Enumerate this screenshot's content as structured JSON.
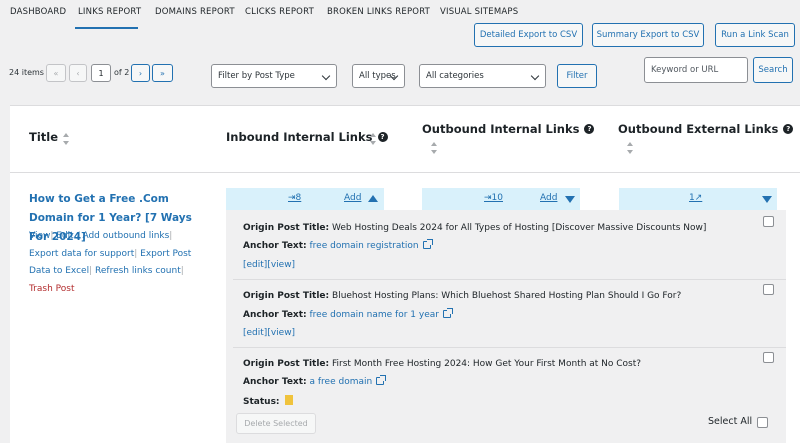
{
  "nav": {
    "tabs": [
      "DASHBOARD",
      "LINKS REPORT",
      "DOMAINS REPORT",
      "CLICKS REPORT",
      "BROKEN LINKS REPORT",
      "VISUAL SITEMAPS"
    ]
  },
  "actions": {
    "detailed_export": "Detailed Export to CSV",
    "summary_export": "Summary Export to CSV",
    "run_scan": "Run a Link Scan"
  },
  "pagination": {
    "items_count": "24 items",
    "first": "«",
    "prev": "‹",
    "current_page": "1",
    "of_total": "of 2",
    "next": "›",
    "last": "»"
  },
  "filters": {
    "post_type": "Filter by Post Type",
    "types": "All types",
    "categories": "All categories",
    "filter_button": "Filter",
    "search_placeholder": "Keyword or URL",
    "search_button": "Search"
  },
  "table": {
    "headers": {
      "title": "Title",
      "inbound": "Inbound Internal Links",
      "outbound_internal": "Outbound Internal Links",
      "outbound_external": "Outbound External Links"
    },
    "help_glyph": "?"
  },
  "row": {
    "title": "How to Get a Free .Com Domain for 1 Year? [7 Ways For 2024]",
    "actions": {
      "view": "View",
      "edit": "Edit / Add outbound links",
      "export": "Export data for support",
      "export_excel": "Export Post Data to Excel",
      "refresh": "Refresh links count",
      "trash": "Trash Post",
      "sep": "|"
    },
    "inbound_count": "⇥8",
    "outbound_internal_count": "⇥10",
    "outbound_external_count": "1↗",
    "add_label": "Add"
  },
  "entries": [
    {
      "origin_label": "Origin Post Title:",
      "origin_title": "Web Hosting Deals 2024 for All Types of Hosting [Discover Massive Discounts Now]",
      "anchor_label": "Anchor Text:",
      "anchor_text": "free domain registration",
      "edit": "[edit]",
      "view": "[view]"
    },
    {
      "origin_label": "Origin Post Title:",
      "origin_title": "Bluehost Hosting Plans: Which Bluehost Shared Hosting Plan Should I Go For?",
      "anchor_label": "Anchor Text:",
      "anchor_text": "free domain name for 1 year",
      "edit": "[edit]",
      "view": "[view]"
    },
    {
      "origin_label": "Origin Post Title:",
      "origin_title": "First Month Free Hosting 2024: How Get Your First Month at No Cost?",
      "anchor_label": "Anchor Text:",
      "anchor_text": "a free domain",
      "status_label": "Status:"
    }
  ],
  "footer": {
    "delete_selected": "Delete Selected",
    "select_all": "Select All"
  },
  "colors": {
    "accent": "#2271b1",
    "count_bar": "#d9f1fb",
    "danger": "#b32d2e",
    "status_flag": "#f0c33c"
  }
}
